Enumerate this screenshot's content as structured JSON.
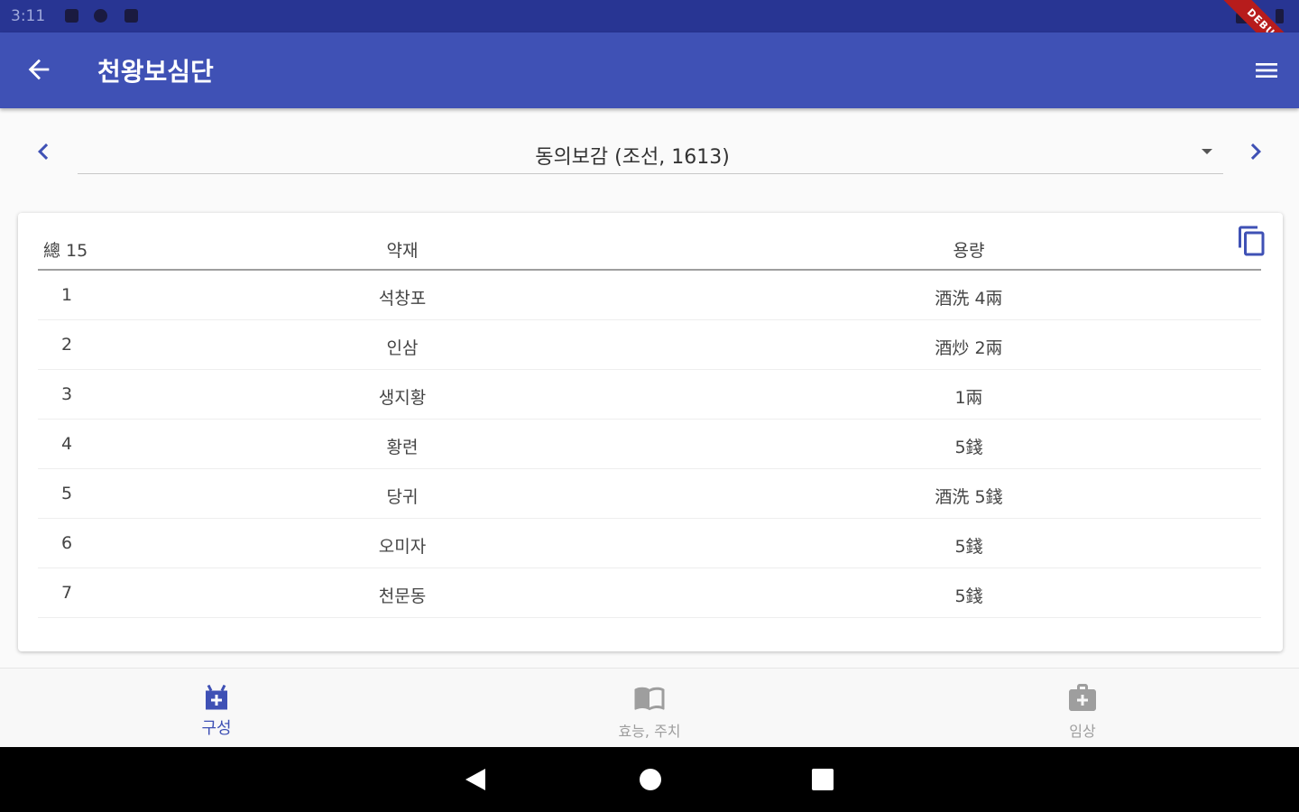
{
  "status_bar": {
    "time": "3:11"
  },
  "debug_banner": "DEBUG",
  "app_bar": {
    "title": "천왕보심단"
  },
  "source_selector": {
    "selected": "동의보감 (조선, 1613)"
  },
  "table": {
    "headers": {
      "index": "總 15",
      "herb": "약재",
      "amount": "용량"
    },
    "rows": [
      {
        "index": "1",
        "herb": "석창포",
        "amount": "酒洗 4兩"
      },
      {
        "index": "2",
        "herb": "인삼",
        "amount": "酒炒 2兩"
      },
      {
        "index": "3",
        "herb": "생지황",
        "amount": "1兩"
      },
      {
        "index": "4",
        "herb": "황련",
        "amount": "5錢"
      },
      {
        "index": "5",
        "herb": "당귀",
        "amount": "酒洗 5錢"
      },
      {
        "index": "6",
        "herb": "오미자",
        "amount": "5錢"
      },
      {
        "index": "7",
        "herb": "천문동",
        "amount": "5錢"
      }
    ]
  },
  "bottom_nav": {
    "tabs": [
      {
        "label": "구성",
        "icon": "composition-icon",
        "active": true
      },
      {
        "label": "효능, 주치",
        "icon": "book-icon",
        "active": false
      },
      {
        "label": "임상",
        "icon": "medical-kit-icon",
        "active": false
      }
    ]
  },
  "colors": {
    "primary": "#3f51b5",
    "status_bar": "#283593",
    "accent": "#3f51b5"
  }
}
